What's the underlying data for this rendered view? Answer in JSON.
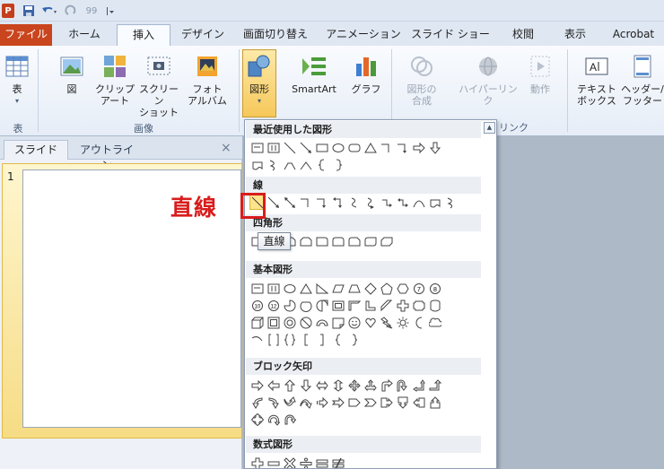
{
  "qat": {
    "app_letter": "P",
    "extra_text": "99"
  },
  "tabs": [
    {
      "label": "ファイル"
    },
    {
      "label": "ホーム"
    },
    {
      "label": "挿入"
    },
    {
      "label": "デザイン"
    },
    {
      "label": "画面切り替え"
    },
    {
      "label": "アニメーション"
    },
    {
      "label": "スライド ショー"
    },
    {
      "label": "校閲"
    },
    {
      "label": "表示"
    },
    {
      "label": "Acrobat"
    }
  ],
  "ribbon": {
    "table": {
      "label": "表",
      "group": "表"
    },
    "picture": {
      "label": "図"
    },
    "clipart": {
      "line1": "クリップ",
      "line2": "アート"
    },
    "screenshot": {
      "line1": "スクリーン",
      "line2": "ショット"
    },
    "photoalbum": {
      "line1": "フォト",
      "line2": "アルバム"
    },
    "images_group": "画像",
    "shapes": {
      "label": "図形"
    },
    "smartart": {
      "label": "SmartArt"
    },
    "chart": {
      "label": "グラフ"
    },
    "merge": {
      "line1": "図形の",
      "line2": "合成"
    },
    "hyperlink": {
      "label": "ハイパーリンク"
    },
    "action": {
      "label": "動作"
    },
    "textbox": {
      "line1": "テキスト",
      "line2": "ボックス"
    },
    "header": {
      "line1": "ヘッダー/",
      "line2": "フッター"
    },
    "links_group_tail": "リンク"
  },
  "slides_panel": {
    "tab_slides": "スライド",
    "tab_outline": "アウトライン",
    "close": "×",
    "slide_number": "1"
  },
  "shapes_panel": {
    "sections": [
      {
        "title": "最近使用した図形"
      },
      {
        "title": "線"
      },
      {
        "title": "四角形"
      },
      {
        "title": "基本図形"
      },
      {
        "title": "ブロック矢印"
      },
      {
        "title": "数式図形"
      }
    ]
  },
  "annotation": {
    "label": "直線",
    "tooltip": "直線"
  }
}
